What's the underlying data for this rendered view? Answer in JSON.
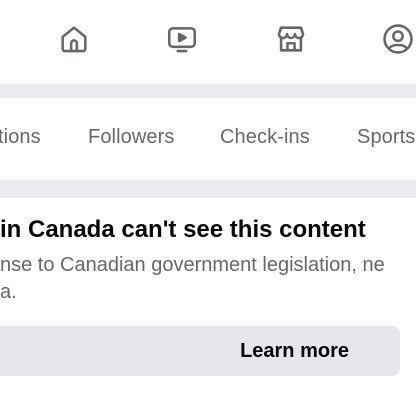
{
  "nav": {
    "icons": [
      "home-icon",
      "video-icon",
      "marketplace-icon",
      "profile-icon"
    ]
  },
  "tabs": [
    {
      "label": "tions"
    },
    {
      "label": "Followers"
    },
    {
      "label": "Check-ins"
    },
    {
      "label": "Sports"
    }
  ],
  "notice": {
    "title": " in Canada can't see this content",
    "body_line1": "nse to Canadian government legislation, ne",
    "body_line2": "a.",
    "button_label": "Learn more"
  },
  "colors": {
    "icon": "#65676b",
    "text_primary": "#050505",
    "text_secondary": "#65676b",
    "button_bg": "#e4e6eb"
  }
}
